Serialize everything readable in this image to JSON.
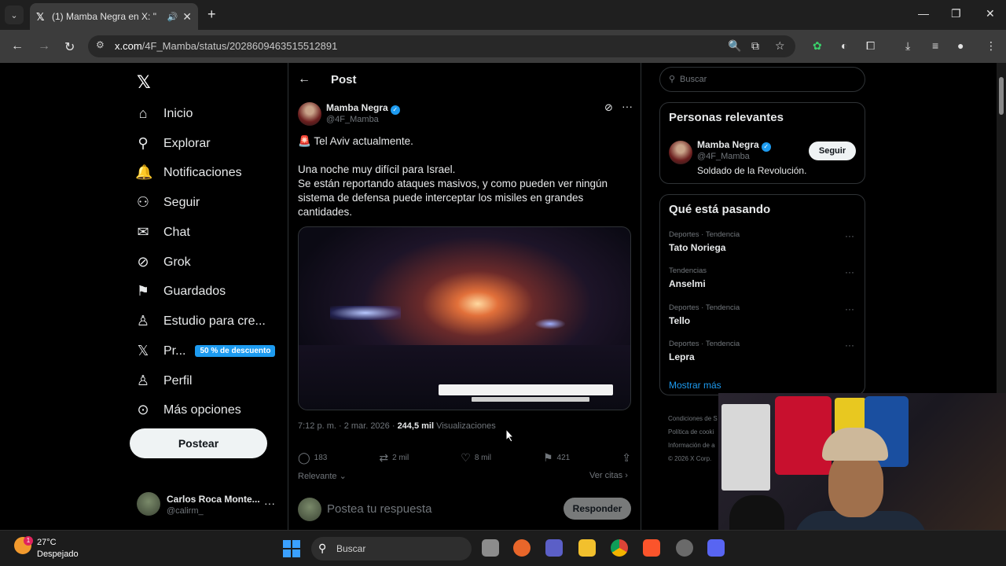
{
  "browser": {
    "tab_title": "(1) Mamba Negra en X: \"",
    "url_prefix": "x.com",
    "url_path": "/4F_Mamba/status/2028609463515512891"
  },
  "sidebar": {
    "items": [
      {
        "label": "Inicio",
        "icon": "home-icon"
      },
      {
        "label": "Explorar",
        "icon": "search-icon"
      },
      {
        "label": "Notificaciones",
        "icon": "bell-icon"
      },
      {
        "label": "Seguir",
        "icon": "add-person-icon"
      },
      {
        "label": "Chat",
        "icon": "mail-icon"
      },
      {
        "label": "Grok",
        "icon": "grok-icon"
      },
      {
        "label": "Guardados",
        "icon": "bookmark-icon"
      },
      {
        "label": "Estudio para cre...",
        "icon": "creator-icon"
      },
      {
        "label": "Pr...",
        "icon": "x-icon"
      },
      {
        "label": "Perfil",
        "icon": "person-icon"
      },
      {
        "label": "Más opciones",
        "icon": "more-icon"
      }
    ],
    "promo_badge": "50 % de descuento",
    "post_button": "Postear",
    "account": {
      "name": "Carlos Roca Monte...",
      "handle": "@calirm_"
    }
  },
  "post": {
    "header": "Post",
    "author_name": "Mamba Negra",
    "author_handle": "@4F_Mamba",
    "text_line1": "Tel Aviv actualmente.",
    "text_line2": "Una noche muy difícil para Israel.",
    "text_line3": "Se están reportando ataques masivos, y como pueden ver ningún sistema de defensa puede interceptar los misiles en grandes cantidades.",
    "timestamp": "7:12 p. m. · 2 mar. 2026 · ",
    "views": "244,5 mil",
    "views_label": " Visualizaciones",
    "replies": "183",
    "reposts": "2 mil",
    "likes": "8 mil",
    "bookmarks": "421",
    "sort_label": "Relevante",
    "quotes_label": "Ver citas",
    "reply_placeholder": "Postea tu respuesta",
    "reply_button": "Responder"
  },
  "right": {
    "search_placeholder": "Buscar",
    "relevant_title": "Personas relevantes",
    "relevant": {
      "name": "Mamba Negra",
      "handle": "@4F_Mamba",
      "bio": "Soldado de la Revolución.",
      "button": "Seguir"
    },
    "trends_title": "Qué está pasando",
    "trends": [
      {
        "category": "Deportes · Tendencia",
        "name": "Tato Noriega"
      },
      {
        "category": "Tendencias",
        "name": "Anselmi"
      },
      {
        "category": "Deportes · Tendencia",
        "name": "Tello"
      },
      {
        "category": "Deportes · Tendencia",
        "name": "Lepra"
      }
    ],
    "show_more": "Mostrar más",
    "footer": [
      "Condiciones de S",
      "Política de cooki",
      "Información de a",
      "© 2026 X Corp."
    ]
  },
  "taskbar": {
    "temperature": "27°C",
    "condition": "Despejado",
    "weather_badge": "1",
    "search_placeholder": "Buscar"
  },
  "colors": {
    "accent": "#1d9bf0",
    "background": "#000000",
    "border": "#2f3336"
  }
}
